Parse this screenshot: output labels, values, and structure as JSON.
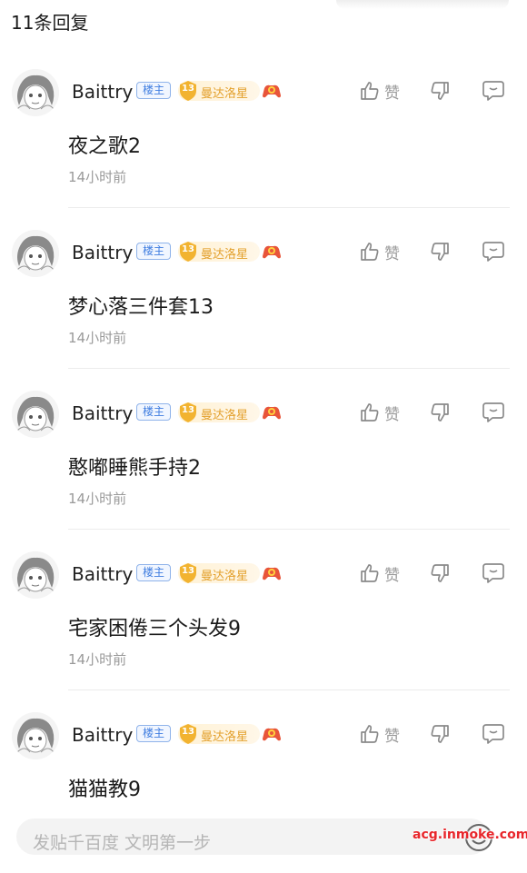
{
  "header": {
    "reply_count": "11条回复"
  },
  "comments": [
    {
      "username": "Baittry",
      "owner_badge": "楼主",
      "level": "13",
      "level_name": "曼达洛星",
      "content": "夜之歌2",
      "time": "14小时前",
      "like_label": "赞"
    },
    {
      "username": "Baittry",
      "owner_badge": "楼主",
      "level": "13",
      "level_name": "曼达洛星",
      "content": "梦心落三件套13",
      "time": "14小时前",
      "like_label": "赞"
    },
    {
      "username": "Baittry",
      "owner_badge": "楼主",
      "level": "13",
      "level_name": "曼达洛星",
      "content": "憨嘟睡熊手持2",
      "time": "14小时前",
      "like_label": "赞"
    },
    {
      "username": "Baittry",
      "owner_badge": "楼主",
      "level": "13",
      "level_name": "曼达洛星",
      "content": "宅家困倦三个头发9",
      "time": "14小时前",
      "like_label": "赞"
    },
    {
      "username": "Baittry",
      "owner_badge": "楼主",
      "level": "13",
      "level_name": "曼达洛星",
      "content": "猫猫教9",
      "time": "",
      "like_label": "赞"
    }
  ],
  "footer": {
    "input_placeholder": "发贴千百度 文明第一步",
    "watermark": "acg.inmoke.com"
  },
  "colors": {
    "owner_badge": "#3f7de0",
    "level_badge": "#e3a02c",
    "secondary_text": "#9a9a9a"
  },
  "icons": [
    "avatar",
    "level-shield-icon",
    "game-controller-icon",
    "thumb-up-icon",
    "thumb-down-icon",
    "reply-bubble-icon",
    "emoji-icon"
  ]
}
